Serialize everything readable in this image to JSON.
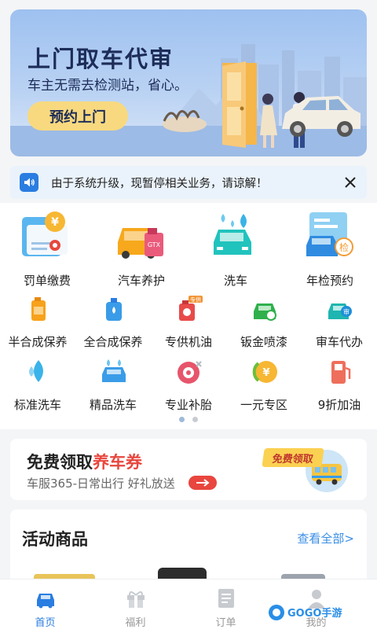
{
  "banner": {
    "title": "上门取车代审",
    "subtitle": "车主无需去检测站，省心。",
    "button": "预约上门"
  },
  "notice": {
    "text": "由于系统升级，现暂停相关业务，请谅解！",
    "icon": "speaker-icon",
    "close_icon": "close-icon"
  },
  "services": {
    "main": [
      {
        "label": "罚单缴费",
        "icon": "ticket-payment-icon"
      },
      {
        "label": "汽车养护",
        "icon": "car-maintenance-icon"
      },
      {
        "label": "洗车",
        "icon": "car-wash-icon"
      },
      {
        "label": "年检预约",
        "icon": "annual-inspection-icon"
      }
    ],
    "row2": [
      {
        "label": "半合成保养",
        "icon": "oil-can-orange-icon"
      },
      {
        "label": "全合成保养",
        "icon": "oil-bottle-blue-icon"
      },
      {
        "label": "专供机油",
        "icon": "engine-oil-icon",
        "badge": "专供"
      },
      {
        "label": "钣金喷漆",
        "icon": "paint-car-icon"
      },
      {
        "label": "审车代办",
        "icon": "inspection-car-icon",
        "badge": "审"
      }
    ],
    "row3": [
      {
        "label": "标准洗车",
        "icon": "water-drop-icon"
      },
      {
        "label": "精品洗车",
        "icon": "premium-wash-icon"
      },
      {
        "label": "专业补胎",
        "icon": "tire-repair-icon"
      },
      {
        "label": "一元专区",
        "icon": "one-yuan-coin-icon",
        "coin": "¥"
      },
      {
        "label": "9折加油",
        "icon": "fuel-pump-icon"
      }
    ]
  },
  "pager": {
    "count": 2,
    "active": 0
  },
  "coupon": {
    "title_prefix": "免费领取",
    "title_highlight": "养车券",
    "subtitle": "车服365-日常出行 好礼放送",
    "badge": "免费领取",
    "highlight_color": "#e8463e"
  },
  "goods": {
    "title": "活动商品",
    "more": "查看全部>"
  },
  "tabs": [
    {
      "label": "首页",
      "icon": "home-car-icon",
      "active": true
    },
    {
      "label": "福利",
      "icon": "gift-icon",
      "active": false
    },
    {
      "label": "订单",
      "icon": "order-list-icon",
      "active": false
    },
    {
      "label": "我的",
      "icon": "profile-icon",
      "active": false
    }
  ],
  "watermark": "GOGO手游网",
  "colors": {
    "accent": "#2a7de1",
    "banner_button": "#f8d97f",
    "coupon_red": "#e8463e"
  }
}
